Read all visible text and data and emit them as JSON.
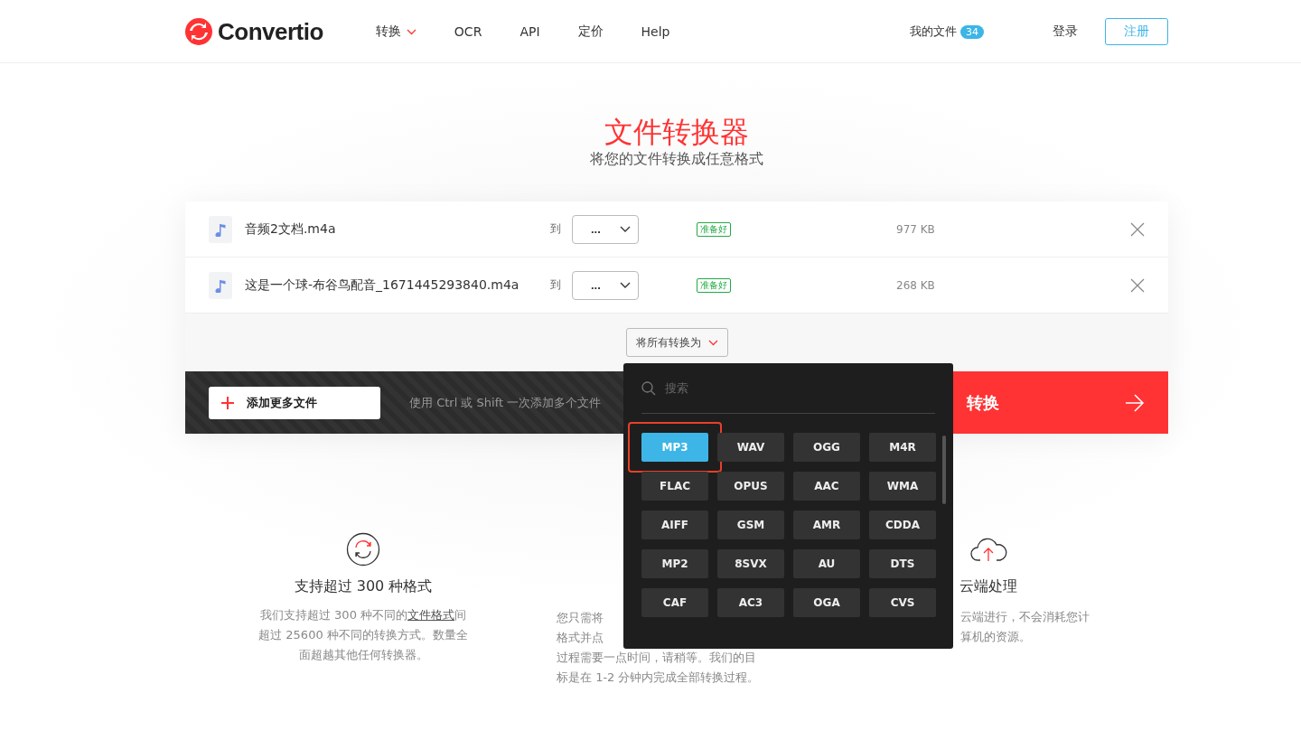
{
  "header": {
    "logo": "Convertio",
    "nav": [
      {
        "label": "转换",
        "caret": true
      },
      {
        "label": "OCR",
        "caret": false
      },
      {
        "label": "API",
        "caret": false
      },
      {
        "label": "定价",
        "caret": false
      },
      {
        "label": "Help",
        "caret": false
      }
    ],
    "my_files": {
      "label": "我的文件",
      "count": "34"
    },
    "login": "登录",
    "signup": "注册"
  },
  "hero": {
    "title": "文件转换器",
    "subtitle": "将您的文件转换成任意格式"
  },
  "files": [
    {
      "name": "音频2文档.m4a",
      "to": "到",
      "format": "...",
      "status": "准备好",
      "size": "977 KB"
    },
    {
      "name": "这是一个球-布谷鸟配音_1671445293840.m4a",
      "to": "到",
      "format": "...",
      "status": "准备好",
      "size": "268 KB"
    }
  ],
  "convert_all": {
    "label": "将所有转换为",
    "open": true
  },
  "toolbar": {
    "add_button": "添加更多文件",
    "hint": "使用 Ctrl 或 Shift 一次添加多个文件",
    "convert_button": "转换"
  },
  "dropdown": {
    "search_placeholder": "搜索",
    "formats": [
      {
        "label": "MP3",
        "selected": true,
        "highlighted": true
      },
      {
        "label": "WAV",
        "selected": false,
        "highlighted": false
      },
      {
        "label": "OGG",
        "selected": false,
        "highlighted": false
      },
      {
        "label": "M4R",
        "selected": false,
        "highlighted": false
      },
      {
        "label": "FLAC",
        "selected": false,
        "highlighted": false
      },
      {
        "label": "OPUS",
        "selected": false,
        "highlighted": false
      },
      {
        "label": "AAC",
        "selected": false,
        "highlighted": false
      },
      {
        "label": "WMA",
        "selected": false,
        "highlighted": false
      },
      {
        "label": "AIFF",
        "selected": false,
        "highlighted": false
      },
      {
        "label": "GSM",
        "selected": false,
        "highlighted": false
      },
      {
        "label": "AMR",
        "selected": false,
        "highlighted": false
      },
      {
        "label": "CDDA",
        "selected": false,
        "highlighted": false
      },
      {
        "label": "MP2",
        "selected": false,
        "highlighted": false
      },
      {
        "label": "8SVX",
        "selected": false,
        "highlighted": false
      },
      {
        "label": "AU",
        "selected": false,
        "highlighted": false
      },
      {
        "label": "DTS",
        "selected": false,
        "highlighted": false
      },
      {
        "label": "CAF",
        "selected": false,
        "highlighted": false
      },
      {
        "label": "AC3",
        "selected": false,
        "highlighted": false
      },
      {
        "label": "OGA",
        "selected": false,
        "highlighted": false
      },
      {
        "label": "CVS",
        "selected": false,
        "highlighted": false
      }
    ]
  },
  "features": [
    {
      "kind": "formats",
      "title": "支持超过 300 种格式",
      "text": "我们支持超过 300 种不同的**文件格式**间超过 25600 种不同的转换方式。数量全面超越其他任何转换器。"
    },
    {
      "kind": "partial",
      "lines": [
        "您只需将",
        "格式并点",
        "过程需要一点时间，请稍等。我们的目",
        "标是在 1-2 分钟内完成全部转换过程。"
      ]
    },
    {
      "kind": "cloud",
      "title": "云端处理",
      "lines": [
        "云端进行，不会消耗您计",
        "算机的资源。"
      ]
    }
  ]
}
